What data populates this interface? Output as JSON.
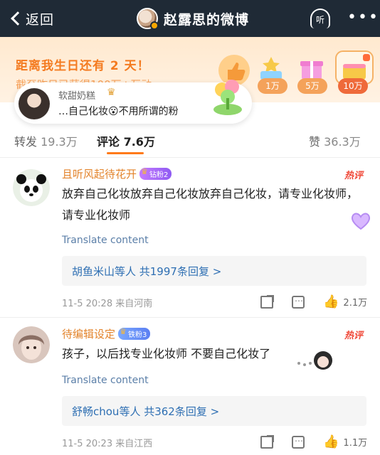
{
  "header": {
    "back_label": "返回",
    "title": "赵露思的微博",
    "listen_label": "听",
    "more_label": "•••"
  },
  "banner": {
    "title": "距离我生日还有 2 天！",
    "subtitle": "截至昨日已获得100万+互动",
    "milestones": [
      "1万",
      "5万",
      "10万"
    ]
  },
  "bubble": {
    "name": "软甜奶糕",
    "text": "…自己化妆😮不用所谓的粉"
  },
  "tabs": {
    "repost_label": "转发",
    "repost_count": "19.3万",
    "comment_label": "评论",
    "comment_count": "7.6万",
    "like_label": "赞",
    "like_count": "36.3万"
  },
  "comments": [
    {
      "name": "且听风起待花开",
      "badge": "钻粉2",
      "hot": "热评",
      "text": "放弃自己化妆放弃自己化妆放弃自己化妆，请专业化妆师，请专业化妆师",
      "translate": "Translate content",
      "replies": "胡鱼米山等人 共1997条回复 >",
      "meta": "11-5 20:28  来自河南",
      "likes": "2.1万"
    },
    {
      "name": "待编辑设定",
      "badge": "铁粉3",
      "hot": "热评",
      "text": "孩子，以后找专业化妆师 不要自己化妆了",
      "translate": "Translate content",
      "replies": "舒畅chou等人 共362条回复 >",
      "meta": "11-5 20:23  来自江西",
      "likes": "1.1万"
    }
  ],
  "colors": {
    "nav_bg": "#1f2a36",
    "accent": "#ff7a1a",
    "username": "#e3842c",
    "link": "#2e6fb3",
    "hot": "#f04a3a"
  }
}
